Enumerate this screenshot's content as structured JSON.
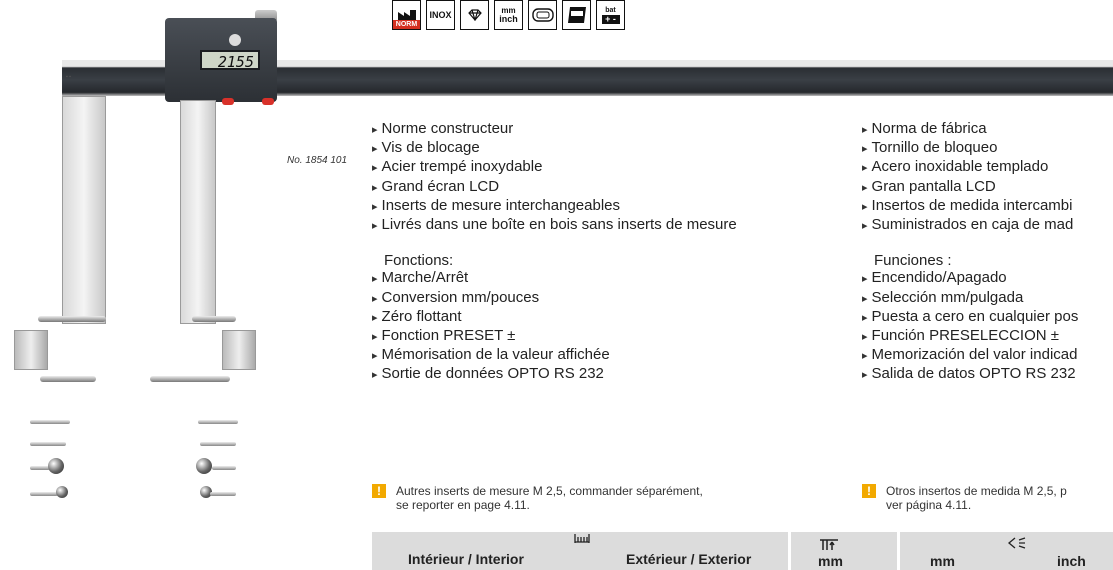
{
  "product": {
    "model_number": "No. 1854 101",
    "display_value": "2155"
  },
  "feature_icons": [
    {
      "name": "norm-icon",
      "label": "NORM"
    },
    {
      "name": "inox-icon",
      "label": "INOX"
    },
    {
      "name": "diamond-icon",
      "label": ""
    },
    {
      "name": "mm-inch-icon",
      "label": "mm inch"
    },
    {
      "name": "data-output-icon",
      "label": ""
    },
    {
      "name": "large-display-icon",
      "label": ""
    },
    {
      "name": "battery-icon",
      "label": "bat"
    }
  ],
  "french": {
    "features": [
      "Norme constructeur",
      "Vis de blocage",
      "Acier trempé inoxydable",
      "Grand écran LCD",
      "Inserts de mesure interchangeables",
      "Livrés dans une boîte en bois sans inserts de mesure"
    ],
    "functions_title": "Fonctions:",
    "functions": [
      "Marche/Arrêt",
      "Conversion mm/pouces",
      "Zéro flottant",
      "Fonction PRESET ±",
      "Mémorisation de la valeur affichée",
      "Sortie de données OPTO RS 232"
    ],
    "note": [
      "Autres inserts de mesure M 2,5, commander séparément,",
      "se reporter en page 4.11."
    ]
  },
  "spanish": {
    "features": [
      "Norma de fábrica",
      "Tornillo de bloqueo",
      "Acero inoxidable templado",
      "Gran pantalla LCD",
      "Insertos de medida intercambi",
      "Suministrados en caja de mad"
    ],
    "functions_title": "Funciones :",
    "functions": [
      "Encendido/Apagado",
      "Selección mm/pulgada",
      "Puesta a cero en cualquier pos",
      "Función  PRESELECCION ±",
      "Memorización del valor indicad",
      "Salida de datos OPTO RS 232"
    ],
    "note": [
      "Otros insertos de medida M 2,5, p",
      "ver página 4.11."
    ]
  },
  "table": {
    "col_interior": "Intérieur / Interior",
    "col_exterior": "Extérieur / Exterior",
    "col_mm": "mm",
    "col_mm2": "mm",
    "col_inch": "inch"
  },
  "colors": {
    "norm_red": "#d43020",
    "note_orange": "#f2a900",
    "table_header_gray": "#dcdcdc"
  }
}
